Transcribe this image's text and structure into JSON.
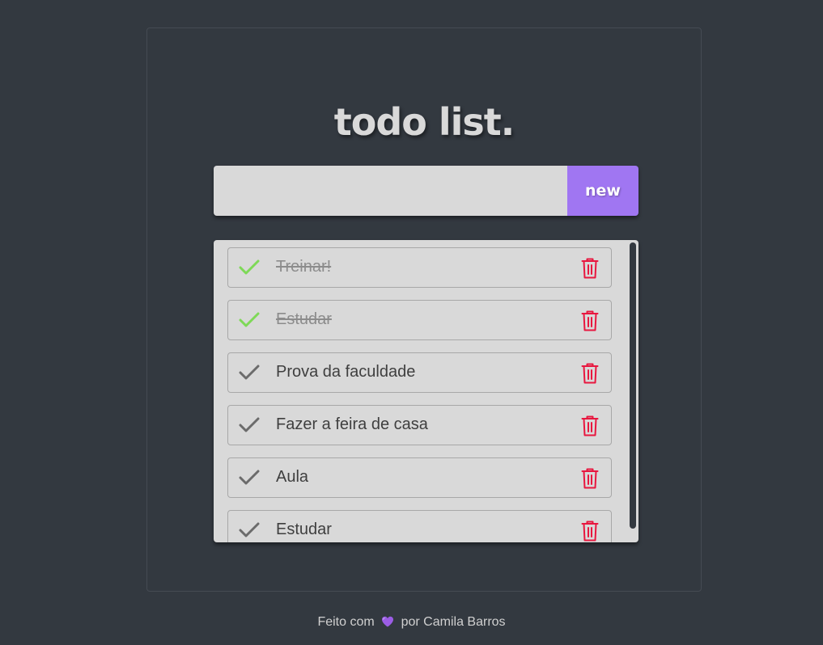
{
  "title": "todo list.",
  "new_todo": {
    "value": "",
    "placeholder": "",
    "button_label": "new"
  },
  "todos": [
    {
      "text": "Treinar!",
      "done": true
    },
    {
      "text": "Estudar",
      "done": true
    },
    {
      "text": "Prova da faculdade",
      "done": false
    },
    {
      "text": "Fazer a feira de casa",
      "done": false
    },
    {
      "text": "Aula",
      "done": false
    },
    {
      "text": "Estudar",
      "done": false
    }
  ],
  "footer": {
    "prefix": "Feito com",
    "heart_icon": "purple-heart-icon",
    "suffix": "por Camila Barros"
  },
  "colors": {
    "background": "#333940",
    "panel": "#d9d9d9",
    "accent": "#a076f2",
    "check_done": "#7ed957",
    "check_pending": "#6b6b6b",
    "delete": "#e8173f"
  }
}
